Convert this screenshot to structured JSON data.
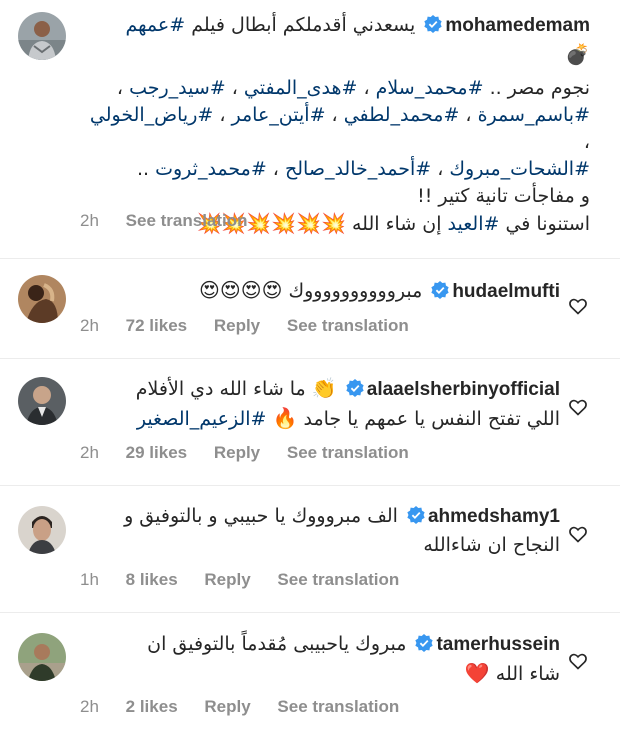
{
  "caption": {
    "username": "mohamedemam",
    "text_intro": "يسعدني أقدملكم أبطال فيلم",
    "intro_tag": "#عمهم",
    "bomb_emoji": "💣",
    "stars_prefix": "نجوم مصر ..",
    "tags_line1": [
      "#محمد_سلام",
      "#هدى_المفتي",
      "#سيد_رجب"
    ],
    "tags_line2": [
      "#باسم_سمرة",
      "#محمد_لطفي",
      "#أيتن_عامر",
      "#رياض_الخولي"
    ],
    "tags_line3": [
      "#الشحات_مبروك",
      "#أحمد_خالد_صالح",
      "#محمد_ثروت"
    ],
    "surprise_text": "و مفاجأت تانية كتير !!",
    "wait_text": "استنونا في",
    "wait_tag": "#العيد",
    "wait_suffix": "إن شاء الله",
    "burst_emojis": "💥💥💥💥💥💥",
    "time": "2h",
    "see_translation": "See translation"
  },
  "comments": [
    {
      "username": "hudaelmufti",
      "text": "مبرووووووووووك",
      "emojis": "😍😍😍😍",
      "time": "2h",
      "likes": "72 likes",
      "reply": "Reply",
      "see_translation": "See translation"
    },
    {
      "username": "alaaelsherbinyofficial",
      "line1": "ما شاء الله دي الأفلام",
      "line1_emoji": "👏",
      "line2_text": "اللي تفتح النفس يا عمهم يا جامد",
      "line2_emoji": "🔥",
      "line2_tag": "#الزعيم_الصغير",
      "time": "2h",
      "likes": "29 likes",
      "reply": "Reply",
      "see_translation": "See translation"
    },
    {
      "username": "ahmedshamy1",
      "line1": "الف مبروووك يا حبيبي و بالتوفيق و",
      "line2": "النجاح ان شاءالله",
      "time": "1h",
      "likes": "8 likes",
      "reply": "Reply",
      "see_translation": "See translation"
    },
    {
      "username": "tamerhussein",
      "line1": "مبروك ياحبيبى مُقدماً بالتوفيق ان",
      "line2": "شاء الله",
      "line2_emoji": "❤️",
      "time": "2h",
      "likes": "2 likes",
      "reply": "Reply",
      "see_translation": "See translation"
    }
  ],
  "colors": {
    "hashtag": "#00376b",
    "meta": "#8e8e8e",
    "verified": "#3897f0",
    "text": "#262626"
  }
}
